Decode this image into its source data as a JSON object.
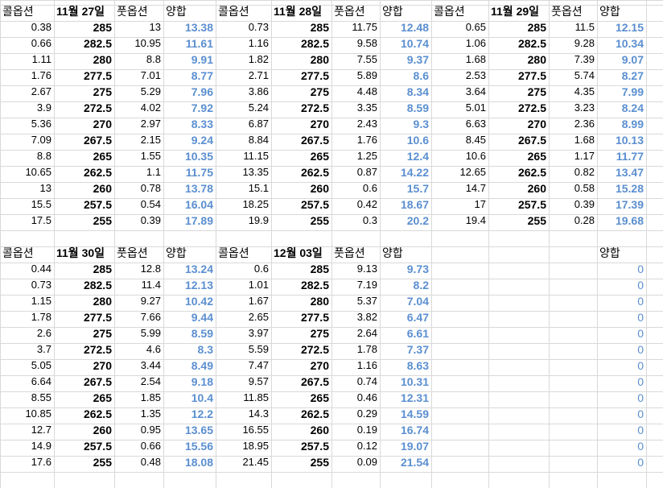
{
  "colors": {
    "sum": "#5b8fd0",
    "grid": "#d9d9d9",
    "text": "#000000"
  },
  "blocks": [
    {
      "h_call": "콜옵션",
      "date": "11월 27일",
      "h_put": "풋옵션",
      "h_sum": "양합",
      "rows": [
        [
          "0.38",
          "285",
          "13",
          "13.38"
        ],
        [
          "0.66",
          "282.5",
          "10.95",
          "11.61"
        ],
        [
          "1.11",
          "280",
          "8.8",
          "9.91"
        ],
        [
          "1.76",
          "277.5",
          "7.01",
          "8.77"
        ],
        [
          "2.67",
          "275",
          "5.29",
          "7.96"
        ],
        [
          "3.9",
          "272.5",
          "4.02",
          "7.92"
        ],
        [
          "5.36",
          "270",
          "2.97",
          "8.33"
        ],
        [
          "7.09",
          "267.5",
          "2.15",
          "9.24"
        ],
        [
          "8.8",
          "265",
          "1.55",
          "10.35"
        ],
        [
          "10.65",
          "262.5",
          "1.1",
          "11.75"
        ],
        [
          "13",
          "260",
          "0.78",
          "13.78"
        ],
        [
          "15.5",
          "257.5",
          "0.54",
          "16.04"
        ],
        [
          "17.5",
          "255",
          "0.39",
          "17.89"
        ]
      ]
    },
    {
      "h_call": "콜옵션",
      "date": "11월 28일",
      "h_put": "풋옵션",
      "h_sum": "양합",
      "rows": [
        [
          "0.73",
          "285",
          "11.75",
          "12.48"
        ],
        [
          "1.16",
          "282.5",
          "9.58",
          "10.74"
        ],
        [
          "1.82",
          "280",
          "7.55",
          "9.37"
        ],
        [
          "2.71",
          "277.5",
          "5.89",
          "8.6"
        ],
        [
          "3.86",
          "275",
          "4.48",
          "8.34"
        ],
        [
          "5.24",
          "272.5",
          "3.35",
          "8.59"
        ],
        [
          "6.87",
          "270",
          "2.43",
          "9.3"
        ],
        [
          "8.84",
          "267.5",
          "1.76",
          "10.6"
        ],
        [
          "11.15",
          "265",
          "1.25",
          "12.4"
        ],
        [
          "13.35",
          "262.5",
          "0.87",
          "14.22"
        ],
        [
          "15.1",
          "260",
          "0.6",
          "15.7"
        ],
        [
          "18.25",
          "257.5",
          "0.42",
          "18.67"
        ],
        [
          "19.9",
          "255",
          "0.3",
          "20.2"
        ]
      ]
    },
    {
      "h_call": "콜옵션",
      "date": "11월 29일",
      "h_put": "풋옵션",
      "h_sum": "양합",
      "rows": [
        [
          "0.65",
          "285",
          "11.5",
          "12.15"
        ],
        [
          "1.06",
          "282.5",
          "9.28",
          "10.34"
        ],
        [
          "1.68",
          "280",
          "7.39",
          "9.07"
        ],
        [
          "2.53",
          "277.5",
          "5.74",
          "8.27"
        ],
        [
          "3.64",
          "275",
          "4.35",
          "7.99"
        ],
        [
          "5.01",
          "272.5",
          "3.23",
          "8.24"
        ],
        [
          "6.63",
          "270",
          "2.36",
          "8.99"
        ],
        [
          "8.45",
          "267.5",
          "1.68",
          "10.13"
        ],
        [
          "10.6",
          "265",
          "1.17",
          "11.77"
        ],
        [
          "12.65",
          "262.5",
          "0.82",
          "13.47"
        ],
        [
          "14.7",
          "260",
          "0.58",
          "15.28"
        ],
        [
          "17",
          "257.5",
          "0.39",
          "17.39"
        ],
        [
          "19.4",
          "255",
          "0.28",
          "19.68"
        ]
      ]
    },
    {
      "h_call": "콜옵션",
      "date": "11월 30일",
      "h_put": "풋옵션",
      "h_sum": "양합",
      "rows": [
        [
          "0.44",
          "285",
          "12.8",
          "13.24"
        ],
        [
          "0.73",
          "282.5",
          "11.4",
          "12.13"
        ],
        [
          "1.15",
          "280",
          "9.27",
          "10.42"
        ],
        [
          "1.78",
          "277.5",
          "7.66",
          "9.44"
        ],
        [
          "2.6",
          "275",
          "5.99",
          "8.59"
        ],
        [
          "3.7",
          "272.5",
          "4.6",
          "8.3"
        ],
        [
          "5.05",
          "270",
          "3.44",
          "8.49"
        ],
        [
          "6.64",
          "267.5",
          "2.54",
          "9.18"
        ],
        [
          "8.55",
          "265",
          "1.85",
          "10.4"
        ],
        [
          "10.85",
          "262.5",
          "1.35",
          "12.2"
        ],
        [
          "12.7",
          "260",
          "0.95",
          "13.65"
        ],
        [
          "14.9",
          "257.5",
          "0.66",
          "15.56"
        ],
        [
          "17.6",
          "255",
          "0.48",
          "18.08"
        ]
      ]
    },
    {
      "h_call": "콜옵션",
      "date": "12월 03일",
      "h_put": "풋옵션",
      "h_sum": "양합",
      "rows": [
        [
          "0.6",
          "285",
          "9.13",
          "9.73"
        ],
        [
          "1.01",
          "282.5",
          "7.19",
          "8.2"
        ],
        [
          "1.67",
          "280",
          "5.37",
          "7.04"
        ],
        [
          "2.65",
          "277.5",
          "3.82",
          "6.47"
        ],
        [
          "3.97",
          "275",
          "2.64",
          "6.61"
        ],
        [
          "5.59",
          "272.5",
          "1.78",
          "7.37"
        ],
        [
          "7.47",
          "270",
          "1.16",
          "8.63"
        ],
        [
          "9.57",
          "267.5",
          "0.74",
          "10.31"
        ],
        [
          "11.85",
          "265",
          "0.46",
          "12.31"
        ],
        [
          "14.3",
          "262.5",
          "0.29",
          "14.59"
        ],
        [
          "16.55",
          "260",
          "0.19",
          "16.74"
        ],
        [
          "18.95",
          "257.5",
          "0.12",
          "19.07"
        ],
        [
          "21.45",
          "255",
          "0.09",
          "21.54"
        ]
      ]
    },
    {
      "h_call": "",
      "date": "",
      "h_put": "",
      "h_sum": "양합",
      "rows": [
        [
          "",
          "",
          "",
          "0"
        ],
        [
          "",
          "",
          "",
          "0"
        ],
        [
          "",
          "",
          "",
          "0"
        ],
        [
          "",
          "",
          "",
          "0"
        ],
        [
          "",
          "",
          "",
          "0"
        ],
        [
          "",
          "",
          "",
          "0"
        ],
        [
          "",
          "",
          "",
          "0"
        ],
        [
          "",
          "",
          "",
          "0"
        ],
        [
          "",
          "",
          "",
          "0"
        ],
        [
          "",
          "",
          "",
          "0"
        ],
        [
          "",
          "",
          "",
          "0"
        ],
        [
          "",
          "",
          "",
          "0"
        ],
        [
          "",
          "",
          "",
          "0"
        ]
      ]
    }
  ]
}
